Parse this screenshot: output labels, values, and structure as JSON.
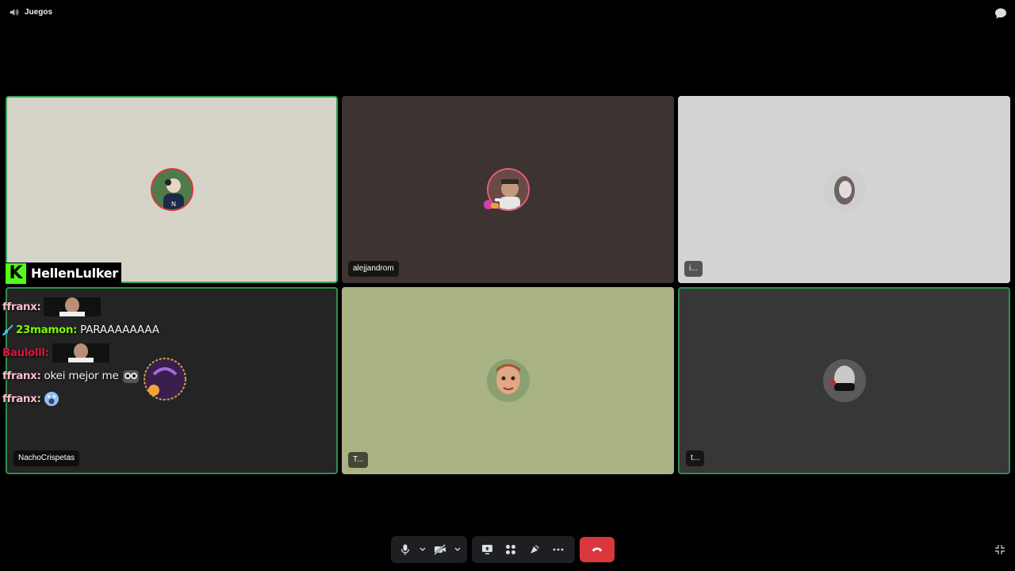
{
  "header": {
    "channel_name": "Juegos",
    "channel_icon": "speaker-icon",
    "chat_icon": "chat-bubble-icon"
  },
  "overlay": {
    "brand_logo": "K",
    "brand_name": "HellenLulker",
    "messages": [
      {
        "user": "ffranx",
        "color": "#ffc0cb",
        "text": "",
        "emote": "face-image"
      },
      {
        "user": "23mamon",
        "color": "#7cfc00",
        "text": "PARAAAAAAAA",
        "badge": "sword-badge"
      },
      {
        "user": "Baulolll",
        "color": "#dc143c",
        "text": "",
        "emote": "face-image"
      },
      {
        "user": "ffranx",
        "color": "#ffc0cb",
        "text": "okei mejor me",
        "emote": "cat-emote"
      },
      {
        "user": "ffranx",
        "color": "#ffc0cb",
        "text": "",
        "emote": "shocked-emote"
      }
    ]
  },
  "tiles": [
    {
      "name": "",
      "bg": "#d6d3c9",
      "border": "speaking"
    },
    {
      "name": "alejjandrom",
      "bg": "#3d3330",
      "border": ""
    },
    {
      "name": "i...",
      "bg": "#d3d3d5",
      "border": ""
    },
    {
      "name": "NachoCrispetas",
      "bg": "#242424",
      "border": "speaking"
    },
    {
      "name": "T...",
      "bg": "#a9b383",
      "border": ""
    },
    {
      "name": "t...",
      "bg": "#373737",
      "border": "speaking"
    }
  ],
  "toolbar": {
    "mic": "microphone-icon",
    "camera": "camera-off-icon",
    "screenshare": "screen-share-icon",
    "activities": "activities-icon",
    "soundboard": "soundboard-icon",
    "more": "more-icon",
    "hangup": "hang-up-icon",
    "fullscreen": "exit-fullscreen-icon"
  }
}
